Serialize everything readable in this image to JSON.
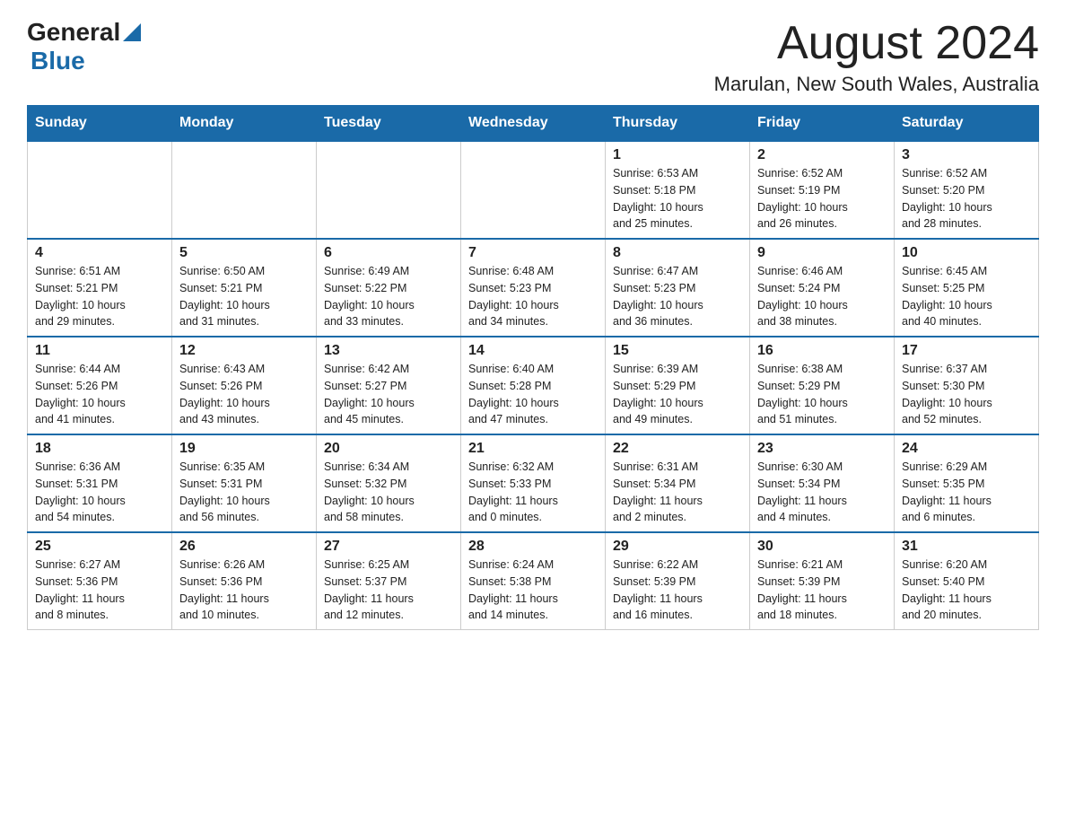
{
  "header": {
    "logo_general": "General",
    "logo_blue": "Blue",
    "title": "August 2024",
    "subtitle": "Marulan, New South Wales, Australia"
  },
  "columns": [
    "Sunday",
    "Monday",
    "Tuesday",
    "Wednesday",
    "Thursday",
    "Friday",
    "Saturday"
  ],
  "weeks": [
    [
      {
        "day": "",
        "info": ""
      },
      {
        "day": "",
        "info": ""
      },
      {
        "day": "",
        "info": ""
      },
      {
        "day": "",
        "info": ""
      },
      {
        "day": "1",
        "info": "Sunrise: 6:53 AM\nSunset: 5:18 PM\nDaylight: 10 hours\nand 25 minutes."
      },
      {
        "day": "2",
        "info": "Sunrise: 6:52 AM\nSunset: 5:19 PM\nDaylight: 10 hours\nand 26 minutes."
      },
      {
        "day": "3",
        "info": "Sunrise: 6:52 AM\nSunset: 5:20 PM\nDaylight: 10 hours\nand 28 minutes."
      }
    ],
    [
      {
        "day": "4",
        "info": "Sunrise: 6:51 AM\nSunset: 5:21 PM\nDaylight: 10 hours\nand 29 minutes."
      },
      {
        "day": "5",
        "info": "Sunrise: 6:50 AM\nSunset: 5:21 PM\nDaylight: 10 hours\nand 31 minutes."
      },
      {
        "day": "6",
        "info": "Sunrise: 6:49 AM\nSunset: 5:22 PM\nDaylight: 10 hours\nand 33 minutes."
      },
      {
        "day": "7",
        "info": "Sunrise: 6:48 AM\nSunset: 5:23 PM\nDaylight: 10 hours\nand 34 minutes."
      },
      {
        "day": "8",
        "info": "Sunrise: 6:47 AM\nSunset: 5:23 PM\nDaylight: 10 hours\nand 36 minutes."
      },
      {
        "day": "9",
        "info": "Sunrise: 6:46 AM\nSunset: 5:24 PM\nDaylight: 10 hours\nand 38 minutes."
      },
      {
        "day": "10",
        "info": "Sunrise: 6:45 AM\nSunset: 5:25 PM\nDaylight: 10 hours\nand 40 minutes."
      }
    ],
    [
      {
        "day": "11",
        "info": "Sunrise: 6:44 AM\nSunset: 5:26 PM\nDaylight: 10 hours\nand 41 minutes."
      },
      {
        "day": "12",
        "info": "Sunrise: 6:43 AM\nSunset: 5:26 PM\nDaylight: 10 hours\nand 43 minutes."
      },
      {
        "day": "13",
        "info": "Sunrise: 6:42 AM\nSunset: 5:27 PM\nDaylight: 10 hours\nand 45 minutes."
      },
      {
        "day": "14",
        "info": "Sunrise: 6:40 AM\nSunset: 5:28 PM\nDaylight: 10 hours\nand 47 minutes."
      },
      {
        "day": "15",
        "info": "Sunrise: 6:39 AM\nSunset: 5:29 PM\nDaylight: 10 hours\nand 49 minutes."
      },
      {
        "day": "16",
        "info": "Sunrise: 6:38 AM\nSunset: 5:29 PM\nDaylight: 10 hours\nand 51 minutes."
      },
      {
        "day": "17",
        "info": "Sunrise: 6:37 AM\nSunset: 5:30 PM\nDaylight: 10 hours\nand 52 minutes."
      }
    ],
    [
      {
        "day": "18",
        "info": "Sunrise: 6:36 AM\nSunset: 5:31 PM\nDaylight: 10 hours\nand 54 minutes."
      },
      {
        "day": "19",
        "info": "Sunrise: 6:35 AM\nSunset: 5:31 PM\nDaylight: 10 hours\nand 56 minutes."
      },
      {
        "day": "20",
        "info": "Sunrise: 6:34 AM\nSunset: 5:32 PM\nDaylight: 10 hours\nand 58 minutes."
      },
      {
        "day": "21",
        "info": "Sunrise: 6:32 AM\nSunset: 5:33 PM\nDaylight: 11 hours\nand 0 minutes."
      },
      {
        "day": "22",
        "info": "Sunrise: 6:31 AM\nSunset: 5:34 PM\nDaylight: 11 hours\nand 2 minutes."
      },
      {
        "day": "23",
        "info": "Sunrise: 6:30 AM\nSunset: 5:34 PM\nDaylight: 11 hours\nand 4 minutes."
      },
      {
        "day": "24",
        "info": "Sunrise: 6:29 AM\nSunset: 5:35 PM\nDaylight: 11 hours\nand 6 minutes."
      }
    ],
    [
      {
        "day": "25",
        "info": "Sunrise: 6:27 AM\nSunset: 5:36 PM\nDaylight: 11 hours\nand 8 minutes."
      },
      {
        "day": "26",
        "info": "Sunrise: 6:26 AM\nSunset: 5:36 PM\nDaylight: 11 hours\nand 10 minutes."
      },
      {
        "day": "27",
        "info": "Sunrise: 6:25 AM\nSunset: 5:37 PM\nDaylight: 11 hours\nand 12 minutes."
      },
      {
        "day": "28",
        "info": "Sunrise: 6:24 AM\nSunset: 5:38 PM\nDaylight: 11 hours\nand 14 minutes."
      },
      {
        "day": "29",
        "info": "Sunrise: 6:22 AM\nSunset: 5:39 PM\nDaylight: 11 hours\nand 16 minutes."
      },
      {
        "day": "30",
        "info": "Sunrise: 6:21 AM\nSunset: 5:39 PM\nDaylight: 11 hours\nand 18 minutes."
      },
      {
        "day": "31",
        "info": "Sunrise: 6:20 AM\nSunset: 5:40 PM\nDaylight: 11 hours\nand 20 minutes."
      }
    ]
  ]
}
